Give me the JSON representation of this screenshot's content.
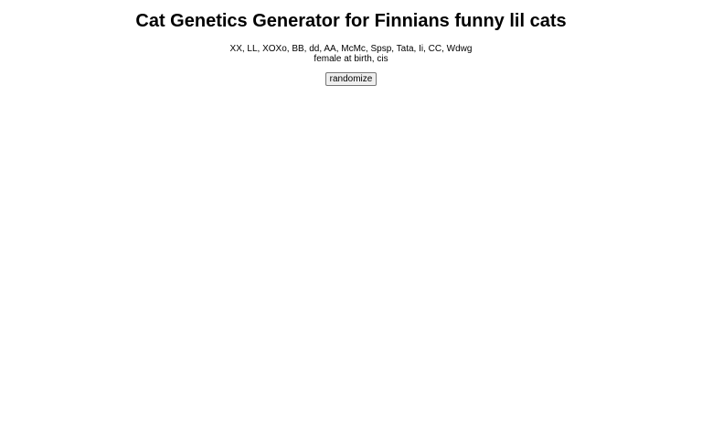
{
  "page": {
    "title": "Cat Genetics Generator for Finnians funny lil cats",
    "genotype": "XX, LL, XOXo, BB, dd, AA, McMc, Spsp, Tata, Ii, CC, Wdwg",
    "sex_line": "female at birth, cis",
    "randomize_label": "randomize"
  }
}
